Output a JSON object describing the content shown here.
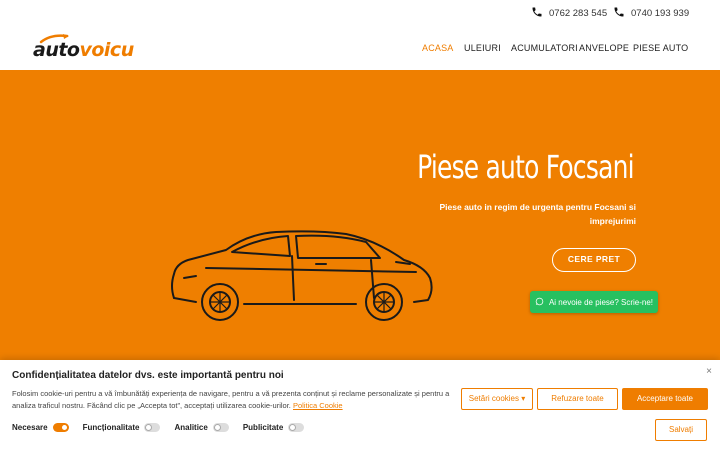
{
  "topbar": {
    "phones": [
      "0762 283 545",
      "0740 193 939"
    ]
  },
  "logo": {
    "part1": "auto",
    "part2": "voicu"
  },
  "nav": {
    "items": [
      {
        "label": "ACASA",
        "active": true
      },
      {
        "label": "ULEIURI",
        "active": false
      },
      {
        "label": "ACUMULATORI",
        "active": false
      },
      {
        "label": "ANVELOPE",
        "active": false
      },
      {
        "label": "PIESE AUTO",
        "active": false
      }
    ]
  },
  "hero": {
    "title": "Piese auto Focsani",
    "subtitle": "Piese auto in regim de urgenta pentru Focsani si imprejurimi",
    "cta_label": "CERE PRET",
    "whatsapp_label": "Ai nevoie de piese? Scrie-ne!",
    "background": "#ef7f00"
  },
  "cookie": {
    "title": "Confidențialitatea datelor dvs. este importantă pentru noi",
    "text": "Folosim cookie-uri pentru a vă îmbunătăți experiența de navigare, pentru a vă prezenta conținut și reclame personalizate și pentru a analiza traficul nostru. Făcând clic pe „Accepta tot”, acceptați utilizarea cookie-urilor.",
    "link": "Politica Cookie",
    "close": "×",
    "buttons": {
      "settings": "Setări cookies",
      "refuse": "Refuzare toate",
      "accept": "Acceptare toate",
      "save": "Salvați"
    },
    "toggles": [
      {
        "label": "Necesare",
        "on": true
      },
      {
        "label": "Funcționalitate",
        "on": false
      },
      {
        "label": "Analitice",
        "on": false
      },
      {
        "label": "Publicitate",
        "on": false
      }
    ]
  },
  "colors": {
    "accent": "#ef7d00",
    "whatsapp": "#27c060"
  }
}
